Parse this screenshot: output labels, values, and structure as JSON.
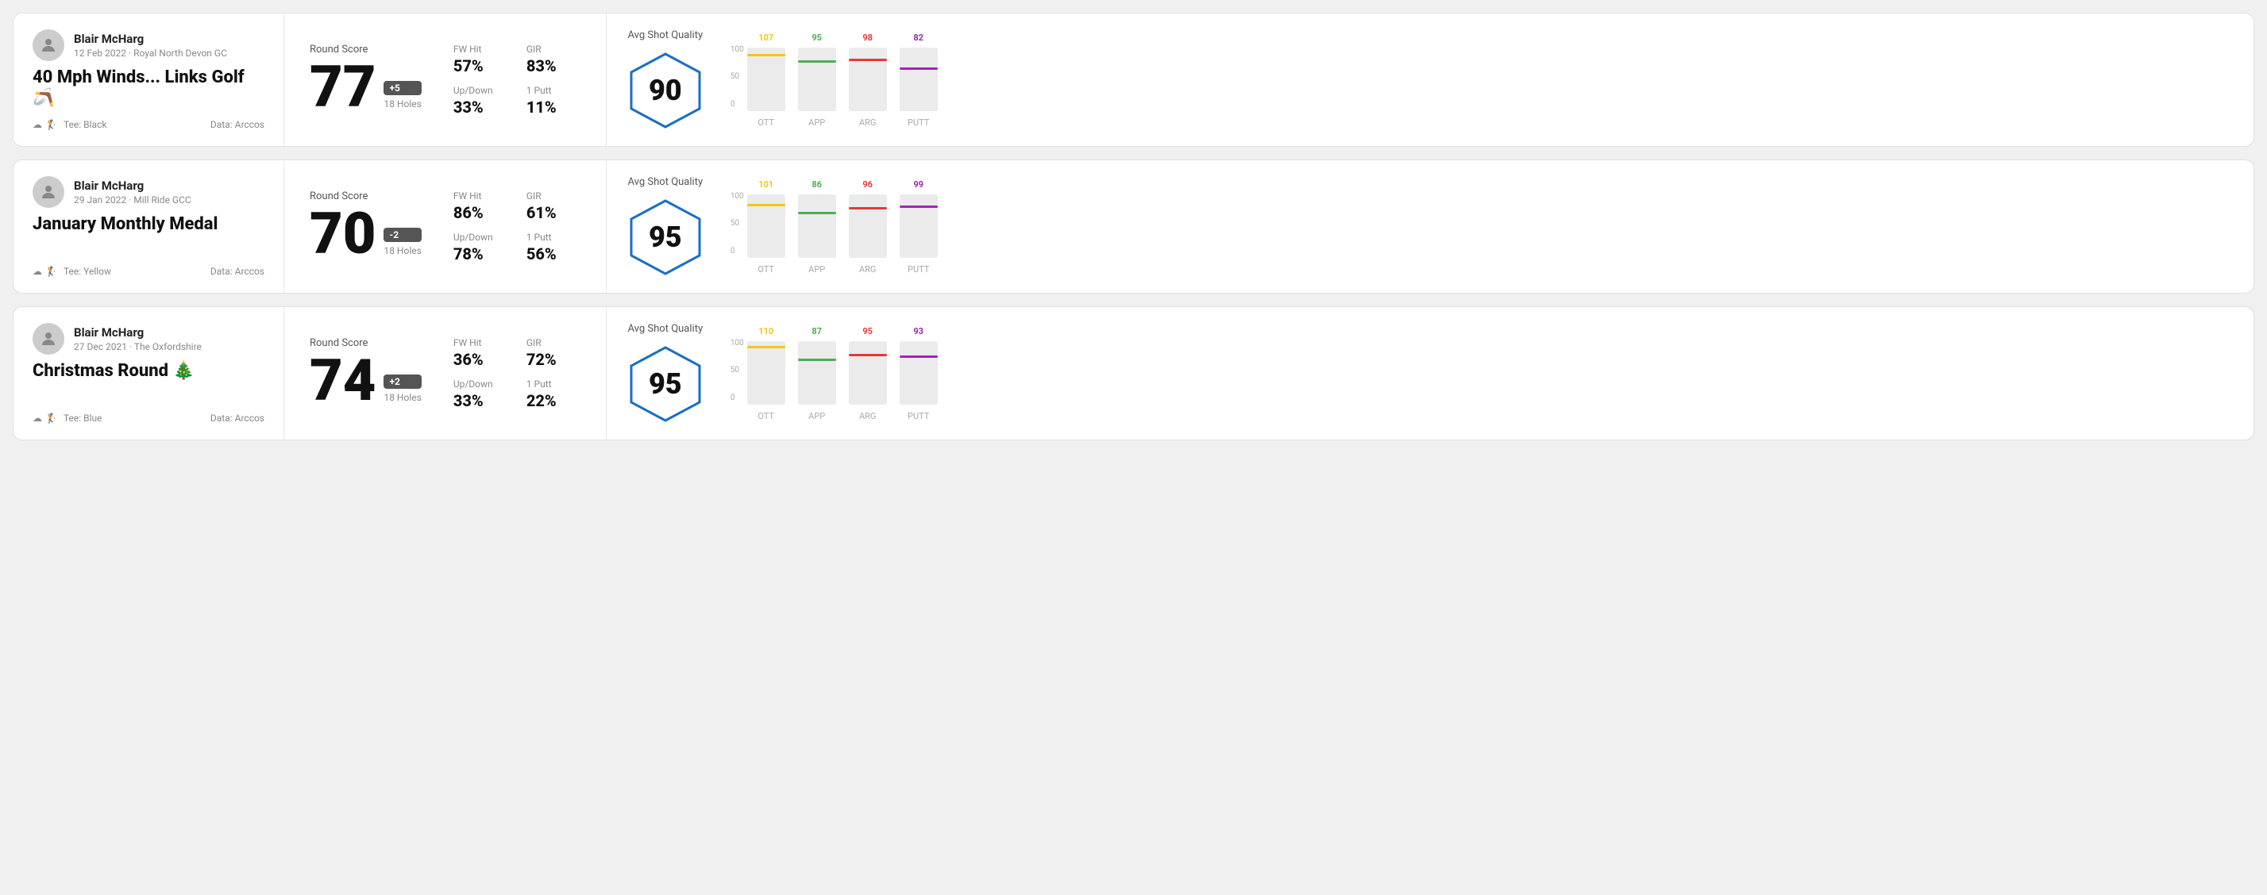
{
  "rounds": [
    {
      "id": "round-1",
      "player": {
        "name": "Blair McHarg",
        "date": "12 Feb 2022 · Royal North Devon GC"
      },
      "title": "40 Mph Winds... Links Golf 🪃",
      "tee": "Black",
      "data_source": "Data: Arccos",
      "score": {
        "label": "Round Score",
        "number": "77",
        "badge": "+5",
        "holes": "18 Holes"
      },
      "stats": {
        "fw_hit_label": "FW Hit",
        "fw_hit_value": "57%",
        "gir_label": "GIR",
        "gir_value": "83%",
        "updown_label": "Up/Down",
        "updown_value": "33%",
        "oneputt_label": "1 Putt",
        "oneputt_value": "11%"
      },
      "avg_shot_quality": {
        "label": "Avg Shot Quality",
        "score": "90"
      },
      "chart": {
        "bars": [
          {
            "label": "OTT",
            "value": 107,
            "color": "#f5c518",
            "max": 120
          },
          {
            "label": "APP",
            "value": 95,
            "color": "#4caf50",
            "max": 120
          },
          {
            "label": "ARG",
            "value": 98,
            "color": "#e53935",
            "max": 120
          },
          {
            "label": "PUTT",
            "value": 82,
            "color": "#9c27b0",
            "max": 120
          }
        ]
      }
    },
    {
      "id": "round-2",
      "player": {
        "name": "Blair McHarg",
        "date": "29 Jan 2022 · Mill Ride GCC"
      },
      "title": "January Monthly Medal",
      "tee": "Yellow",
      "data_source": "Data: Arccos",
      "score": {
        "label": "Round Score",
        "number": "70",
        "badge": "-2",
        "holes": "18 Holes"
      },
      "stats": {
        "fw_hit_label": "FW Hit",
        "fw_hit_value": "86%",
        "gir_label": "GIR",
        "gir_value": "61%",
        "updown_label": "Up/Down",
        "updown_value": "78%",
        "oneputt_label": "1 Putt",
        "oneputt_value": "56%"
      },
      "avg_shot_quality": {
        "label": "Avg Shot Quality",
        "score": "95"
      },
      "chart": {
        "bars": [
          {
            "label": "OTT",
            "value": 101,
            "color": "#f5c518",
            "max": 120
          },
          {
            "label": "APP",
            "value": 86,
            "color": "#4caf50",
            "max": 120
          },
          {
            "label": "ARG",
            "value": 96,
            "color": "#e53935",
            "max": 120
          },
          {
            "label": "PUTT",
            "value": 99,
            "color": "#9c27b0",
            "max": 120
          }
        ]
      }
    },
    {
      "id": "round-3",
      "player": {
        "name": "Blair McHarg",
        "date": "27 Dec 2021 · The Oxfordshire"
      },
      "title": "Christmas Round 🎄",
      "tee": "Blue",
      "data_source": "Data: Arccos",
      "score": {
        "label": "Round Score",
        "number": "74",
        "badge": "+2",
        "holes": "18 Holes"
      },
      "stats": {
        "fw_hit_label": "FW Hit",
        "fw_hit_value": "36%",
        "gir_label": "GIR",
        "gir_value": "72%",
        "updown_label": "Up/Down",
        "updown_value": "33%",
        "oneputt_label": "1 Putt",
        "oneputt_value": "22%"
      },
      "avg_shot_quality": {
        "label": "Avg Shot Quality",
        "score": "95"
      },
      "chart": {
        "bars": [
          {
            "label": "OTT",
            "value": 110,
            "color": "#f5c518",
            "max": 120
          },
          {
            "label": "APP",
            "value": 87,
            "color": "#4caf50",
            "max": 120
          },
          {
            "label": "ARG",
            "value": 95,
            "color": "#e53935",
            "max": 120
          },
          {
            "label": "PUTT",
            "value": 93,
            "color": "#9c27b0",
            "max": 120
          }
        ]
      }
    }
  ],
  "chart_y_labels": [
    "100",
    "50",
    "0"
  ]
}
